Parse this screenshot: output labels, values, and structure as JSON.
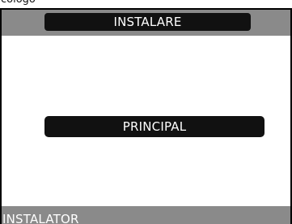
{
  "top_fragment": "cologo",
  "header": {
    "title": "INSTALARE"
  },
  "menu": {
    "items": [
      {
        "label": "PRINCIPAL"
      }
    ]
  },
  "status_bar": {
    "label": "INSTALATOR"
  },
  "colors": {
    "header_band": "#8a8a8a",
    "pill_background": "#111111",
    "pill_text": "#ffffff",
    "status_band": "#8a8a8a",
    "frame": "#000000"
  }
}
